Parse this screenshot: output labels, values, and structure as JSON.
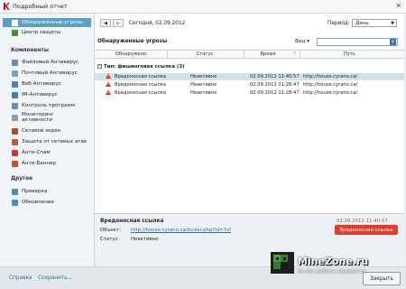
{
  "window": {
    "title": "Подробный отчет"
  },
  "sidebar": {
    "top_items": [
      {
        "label": "Обнаруженные угрозы",
        "icon": "report-icon",
        "color": "#ffffff",
        "selected": true
      },
      {
        "label": "Центр защиты",
        "icon": "shield-icon",
        "color": "#4a8a3a",
        "selected": false
      }
    ],
    "components_header": "Компоненты",
    "components": [
      {
        "label": "Файловый Антивирус",
        "icon": "file-antivirus-icon",
        "color": "#5a8fc8"
      },
      {
        "label": "Почтовый Антивирус",
        "icon": "mail-antivirus-icon",
        "color": "#7aa0c8"
      },
      {
        "label": "Веб-Антивирус",
        "icon": "web-antivirus-icon",
        "color": "#4a7fc0"
      },
      {
        "label": "IM-Антивирус",
        "icon": "im-antivirus-icon",
        "color": "#3e7bbf"
      },
      {
        "label": "Контроль программ",
        "icon": "app-control-icon",
        "color": "#6a8fb0"
      },
      {
        "label": "Мониторинг активности",
        "icon": "activity-monitor-icon",
        "color": "#8a9fb5"
      },
      {
        "label": "Сетевой экран",
        "icon": "firewall-icon",
        "color": "#b04a2a"
      },
      {
        "label": "Защита от сетевых атак",
        "icon": "network-attack-icon",
        "color": "#c05a2a"
      },
      {
        "label": "Анти-Спам",
        "icon": "anti-spam-icon",
        "color": "#c83a3a"
      },
      {
        "label": "Анти-Баннер",
        "icon": "anti-banner-icon",
        "color": "#d04a30"
      }
    ],
    "other_header": "Другое",
    "other": [
      {
        "label": "Проверка",
        "icon": "scan-icon",
        "color": "#4a8ac8"
      },
      {
        "label": "Обновление",
        "icon": "update-icon",
        "color": "#4a8ac8"
      }
    ]
  },
  "toolbar": {
    "back_glyph": "◀",
    "forward_glyph": "▶",
    "date_label": "Сегодня, 02.09.2012",
    "period_label": "Период:",
    "period_value": "День"
  },
  "threats": {
    "section_title": "Обнаруженные угрозы",
    "view_label": "Вид ▾",
    "search_placeholder": "",
    "columns": [
      "Обнаружено",
      "Статус",
      "Время",
      "Путь"
    ],
    "group_label": "Тип: фишинговая ссылка (3)",
    "rows": [
      {
        "detected": "Вредоносная ссылка",
        "status": "Неактивно",
        "time": "02.09.2012 11:40:57",
        "path": "http://house.cyrano.ca/",
        "selected": true
      },
      {
        "detected": "Вредоносная ссылка",
        "status": "Неактивно",
        "time": "02.09.2012 11:28:47",
        "path": "http://house.cyrano.ca/",
        "selected": false
      },
      {
        "detected": "Вредоносная ссылка",
        "status": "Неактивно",
        "time": "02.09.2012 11:28:47",
        "path": "http://house.cyrano.ca/",
        "selected": false
      }
    ]
  },
  "details": {
    "title": "Вредоносная ссылка",
    "timestamp": "02.09.2012 11:40:57",
    "object_label": "Объект:",
    "object_value": "http://house.cyrano.ca/locker.php?id=7vf",
    "status_label": "Статус:",
    "status_value": "Неактивно",
    "badge": "Вредоносная ссылка",
    "badge_color": "#e23c2a"
  },
  "bottom": {
    "help_link": "Справка",
    "save_link": "Сохранить...",
    "close_button": "Закрыть"
  },
  "watermark": {
    "brand": "MineZone.ru",
    "slogan": "Не все зелёное взрывается"
  }
}
